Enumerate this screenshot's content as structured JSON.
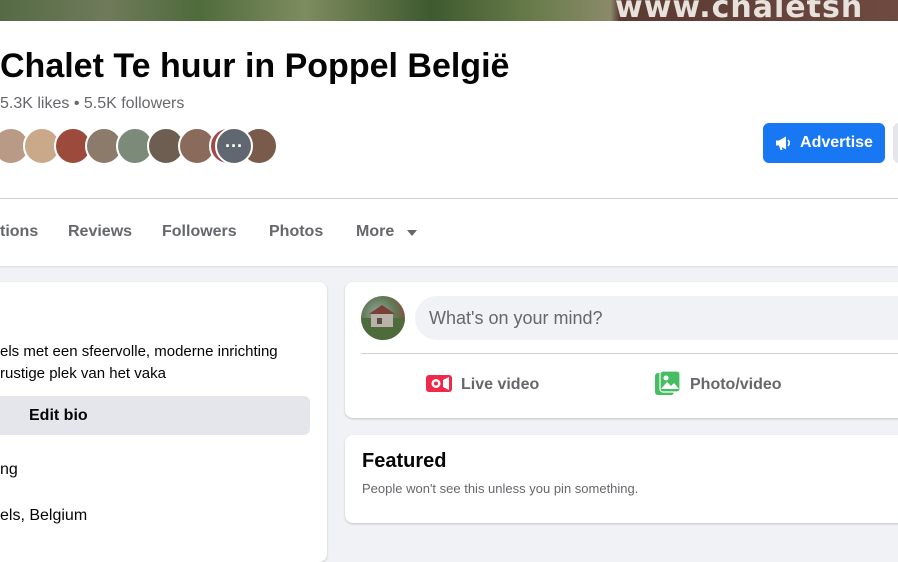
{
  "cover": {
    "watermark_text": "www.chaletsh"
  },
  "page": {
    "title": "Chalet Te huur in Poppel België",
    "stats": "5.3K likes • 5.5K followers"
  },
  "follower_avatars": [
    {
      "name": "follower-avatar-1",
      "color": "#b99a86"
    },
    {
      "name": "follower-avatar-2",
      "color": "#c9a98a"
    },
    {
      "name": "follower-avatar-3",
      "color": "#9c4a3c"
    },
    {
      "name": "follower-avatar-4",
      "color": "#8c7a6a"
    },
    {
      "name": "follower-avatar-5",
      "color": "#7c8a7a"
    },
    {
      "name": "follower-avatar-6",
      "color": "#6e5e52"
    },
    {
      "name": "follower-avatar-7",
      "color": "#8a6a5a"
    },
    {
      "name": "follower-avatar-8",
      "color": "#a04a4a"
    },
    {
      "name": "follower-avatar-9",
      "color": "#7a5a4a"
    },
    {
      "name": "follower-avatar-more",
      "color": "#606770",
      "label": "···"
    }
  ],
  "actions": {
    "advertise_label": "Advertise",
    "advertise_icon": "megaphone-icon"
  },
  "tabs": [
    {
      "label": "tions",
      "name": "tab-mentions"
    },
    {
      "label": "Reviews",
      "name": "tab-reviews"
    },
    {
      "label": "Followers",
      "name": "tab-followers"
    },
    {
      "label": "Photos",
      "name": "tab-photos"
    },
    {
      "label": "More",
      "name": "tab-more",
      "caret_icon": "caret-down-icon"
    }
  ],
  "intro": {
    "bio_line1": "els met een sfeervolle, moderne inrichting",
    "bio_line2": "rustige plek van het vaka",
    "edit_bio_label": "Edit bio",
    "detail_line1": "ng",
    "detail_line2": "els, Belgium"
  },
  "composer": {
    "placeholder": "What's on your mind?",
    "live_video_label": "Live video",
    "live_video_icon": "live-video-icon",
    "live_video_color": "#f02849",
    "photo_video_label": "Photo/video",
    "photo_video_icon": "photo-video-icon",
    "photo_video_color": "#45bd62"
  },
  "featured": {
    "title": "Featured",
    "subtitle": "People won't see this unless you pin something."
  },
  "colors": {
    "accent": "#1877f2",
    "secondary_text": "#65676b",
    "background": "#f0f2f5"
  }
}
